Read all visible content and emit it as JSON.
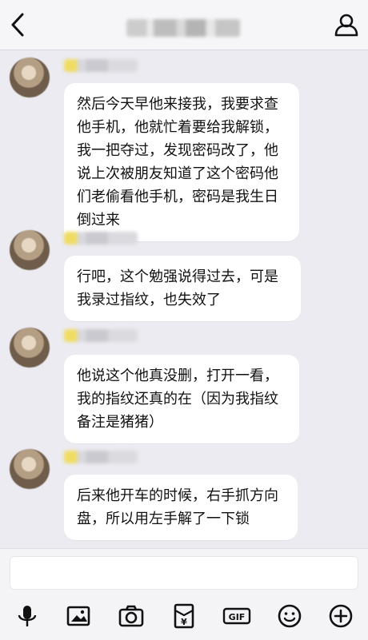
{
  "header": {
    "title": "",
    "back_icon": "chevron-left-icon",
    "contact_icon": "person-icon"
  },
  "messages": [
    {
      "text": "然后今天早他来接我，我要求查他手机，他就忙着要给我解锁，我一把夺过，发现密码改了，他说上次被朋友知道了这个密码他们老偷看他手机，密码是我生日倒过来"
    },
    {
      "text": "行吧，这个勉强说得过去，可是我录过指纹，也失效了"
    },
    {
      "text": "他说这个他真没删，打开一看，我的指纹还真的在（因为我指纹备注是猪猪）"
    },
    {
      "text": "后来他开车的时候，右手抓方向盘，所以用左手解了一下锁"
    }
  ],
  "composer": {
    "placeholder": "",
    "tools": [
      "microphone-icon",
      "image-icon",
      "camera-icon",
      "red-packet-icon",
      "gif-icon",
      "emoji-icon",
      "plus-icon"
    ]
  },
  "colors": {
    "background": "#ebebf1",
    "bubble": "#ffffff",
    "name_highlight": "#f0dc63"
  }
}
